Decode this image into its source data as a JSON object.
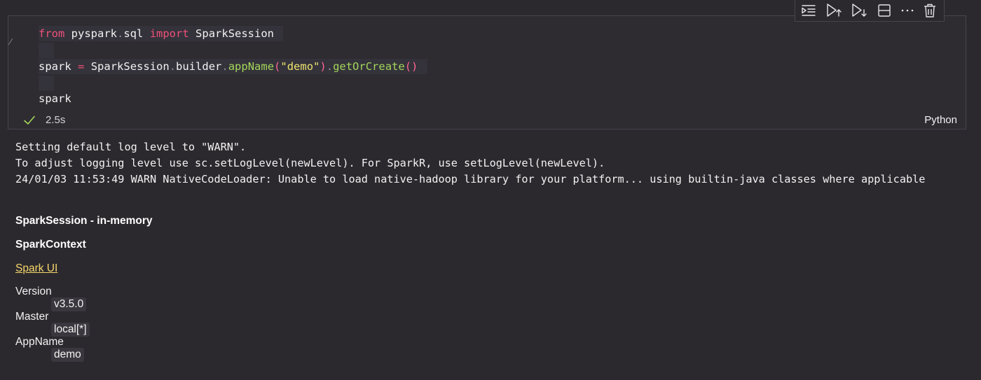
{
  "cell": {
    "code": {
      "line1": {
        "kw1": "from",
        "mod1": "pyspark",
        "dot": ".",
        "mod2": "sql",
        "kw2": "import",
        "cls": "SparkSession"
      },
      "line2": {
        "var": "spark",
        "eq": "=",
        "cls": "SparkSession",
        "dot1": ".",
        "attr": "builder",
        "dot2": ".",
        "fn1": "appName",
        "p1": "(",
        "str": "\"demo\"",
        "p2": ")",
        "dot3": ".",
        "fn2": "getOrCreate",
        "p3": "()"
      },
      "line3": {
        "var": "spark"
      }
    },
    "status": {
      "duration": "2.5s",
      "language": "Python"
    },
    "edge_mark": "⁄"
  },
  "toolbar": {
    "buttons": [
      {
        "icon": "run-by-line-icon"
      },
      {
        "icon": "execute-above-icon"
      },
      {
        "icon": "execute-below-icon"
      },
      {
        "icon": "split-cell-icon"
      },
      {
        "icon": "more-actions-icon"
      },
      {
        "icon": "delete-icon"
      }
    ]
  },
  "output": {
    "log": [
      "Setting default log level to \"WARN\".",
      "To adjust logging level use sc.setLogLevel(newLevel). For SparkR, use setLogLevel(newLevel).",
      "24/01/03 11:53:49 WARN NativeCodeLoader: Unable to load native-hadoop library for your platform... using builtin-java classes where applicable"
    ],
    "session_title": "SparkSession - in-memory",
    "context_title": "SparkContext",
    "spark_ui_link": "Spark UI",
    "details": {
      "version_label": "Version",
      "version_value": "v3.5.0",
      "master_label": "Master",
      "master_value": "local[*]",
      "appname_label": "AppName",
      "appname_value": "demo"
    }
  },
  "colors": {
    "background": "#2b292e",
    "keyword": "#f0517a",
    "function": "#a3d65a",
    "string": "#eee36f",
    "link": "#f6d66a",
    "check": "#a3d65a"
  }
}
